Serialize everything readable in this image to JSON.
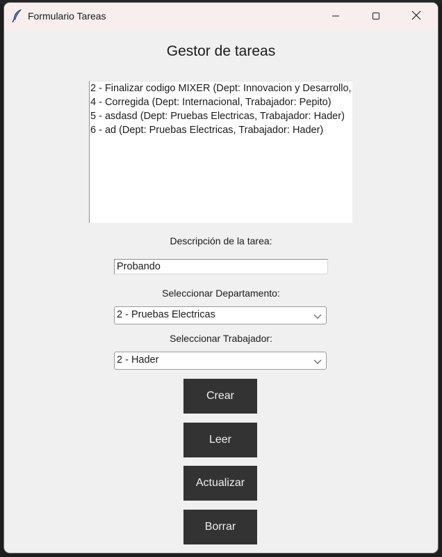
{
  "window": {
    "title": "Formulario Tareas",
    "icon": "feather-icon"
  },
  "app": {
    "heading": "Gestor de tareas"
  },
  "tasks": [
    "2 - Finalizar codigo MIXER (Dept: Innovacion y Desarrollo,",
    "4 - Corregida (Dept: Internacional, Trabajador: Pepito)",
    "5 - asdasd (Dept: Pruebas Electricas, Trabajador: Hader)",
    "6 - ad (Dept: Pruebas Electricas, Trabajador: Hader)"
  ],
  "form": {
    "description_label": "Descripción de la tarea:",
    "description_value": "Probando",
    "department_label": "Seleccionar Departamento:",
    "department_value": "2 - Pruebas Electricas",
    "worker_label": "Seleccionar Trabajador:",
    "worker_value": "2 - Hader"
  },
  "buttons": {
    "create": "Crear",
    "read": "Leer",
    "update": "Actualizar",
    "delete": "Borrar"
  },
  "colors": {
    "button_bg": "#333333",
    "button_text": "#f0f0f0",
    "window_bg": "#f0f0f0",
    "titlebar_bg": "#f9eeee"
  }
}
